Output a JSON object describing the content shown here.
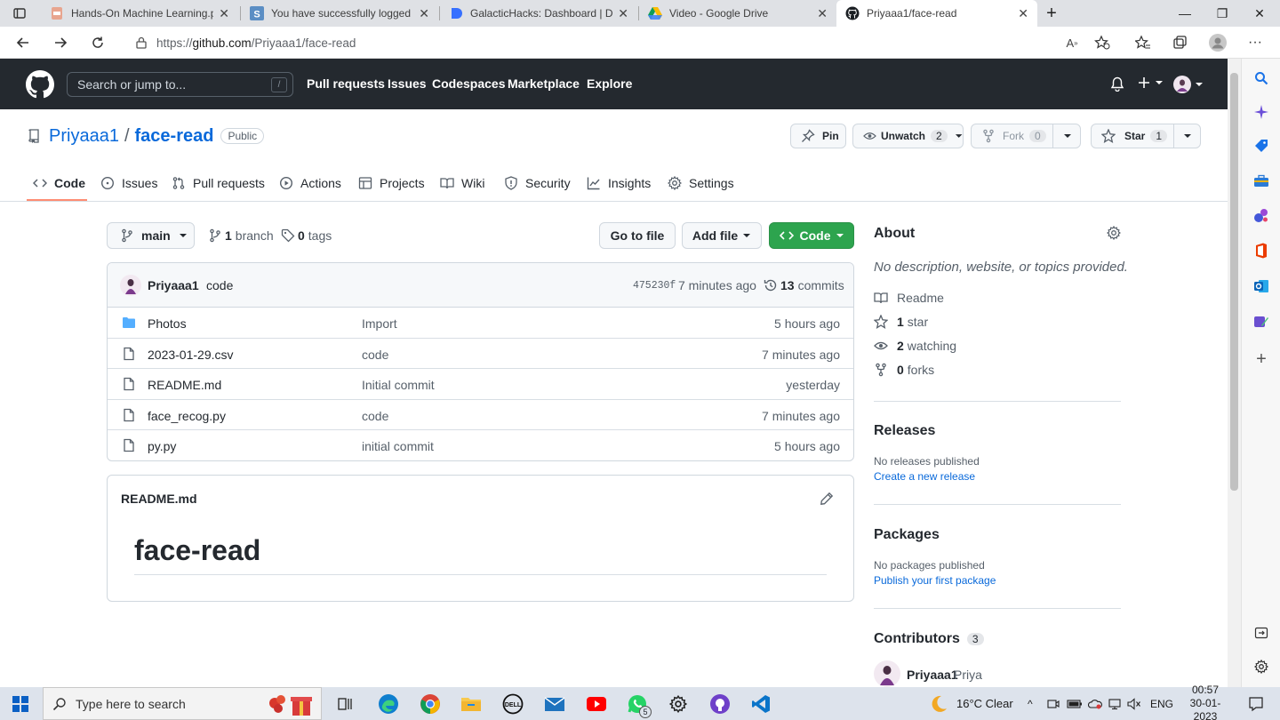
{
  "browser": {
    "tabs": [
      {
        "title": "Hands-On Machine Learning.pdf",
        "icon": "pdf-icon"
      },
      {
        "title": "You have successfully logged on.",
        "icon": "s-icon"
      },
      {
        "title": "GalacticHacks: Dashboard | Devfolio",
        "icon": "devfolio-icon"
      },
      {
        "title": "Video - Google Drive",
        "icon": "google-drive-icon"
      },
      {
        "title": "Priyaaa1/face-read",
        "icon": "github-icon",
        "active": true
      }
    ],
    "url_prefix": "https://",
    "url_host": "github.com",
    "url_path": "/Priyaaa1/face-read"
  },
  "gh_header": {
    "search_placeholder": "Search or jump to...",
    "search_shortcut": "/",
    "nav": [
      "Pull requests",
      "Issues",
      "Codespaces",
      "Marketplace",
      "Explore"
    ]
  },
  "repo": {
    "owner": "Priyaaa1",
    "separator": "/",
    "name": "face-read",
    "visibility": "Public",
    "pin_label": "Pin",
    "unwatch_label": "Unwatch",
    "watch_count": "2",
    "fork_label": "Fork",
    "fork_count": "0",
    "star_label": "Star",
    "star_count": "1",
    "tabs": [
      "Code",
      "Issues",
      "Pull requests",
      "Actions",
      "Projects",
      "Wiki",
      "Security",
      "Insights",
      "Settings"
    ]
  },
  "files_toolbar": {
    "branch": "main",
    "branch_count": "1",
    "branch_label": "branch",
    "tag_count": "0",
    "tag_label": "tags",
    "go_to_file": "Go to file",
    "add_file": "Add file",
    "code": "Code"
  },
  "commit": {
    "author": "Priyaaa1",
    "message": "code",
    "hash": "475230f",
    "time": "7 minutes ago",
    "commit_count": "13",
    "commit_label": "commits"
  },
  "files": [
    {
      "name": "Photos",
      "type": "folder",
      "message": "Import",
      "age": "5 hours ago"
    },
    {
      "name": "2023-01-29.csv",
      "type": "file",
      "message": "code",
      "age": "7 minutes ago"
    },
    {
      "name": "README.md",
      "type": "file",
      "message": "Initial commit",
      "age": "yesterday"
    },
    {
      "name": "face_recog.py",
      "type": "file",
      "message": "code",
      "age": "7 minutes ago"
    },
    {
      "name": "py.py",
      "type": "file",
      "message": "initial commit",
      "age": "5 hours ago"
    }
  ],
  "readme": {
    "filename": "README.md",
    "heading": "face-read"
  },
  "about": {
    "title": "About",
    "description": "No description, website, or topics provided.",
    "readme": "Readme",
    "stars_count": "1",
    "stars_label": "star",
    "watching_count": "2",
    "watching_label": "watching",
    "forks_count": "0",
    "forks_label": "forks",
    "releases_title": "Releases",
    "releases_text": "No releases published",
    "releases_link": "Create a new release",
    "packages_title": "Packages",
    "packages_text": "No packages published",
    "packages_link": "Publish your first package",
    "contributors_title": "Contributors",
    "contributors_count": "3",
    "contributor_login": "Priyaaa1",
    "contributor_name": "Priya"
  },
  "taskbar": {
    "search_placeholder": "Type here to search",
    "whatsapp_badge": "5",
    "weather": "16°C  Clear",
    "lang": "ENG",
    "time": "00:57",
    "date": "30-01-2023"
  },
  "colors": {
    "gh_header_bg": "#24292f",
    "link": "#0969da",
    "code_button": "#2da44e",
    "active_tab_underline": "#fd8c73"
  }
}
